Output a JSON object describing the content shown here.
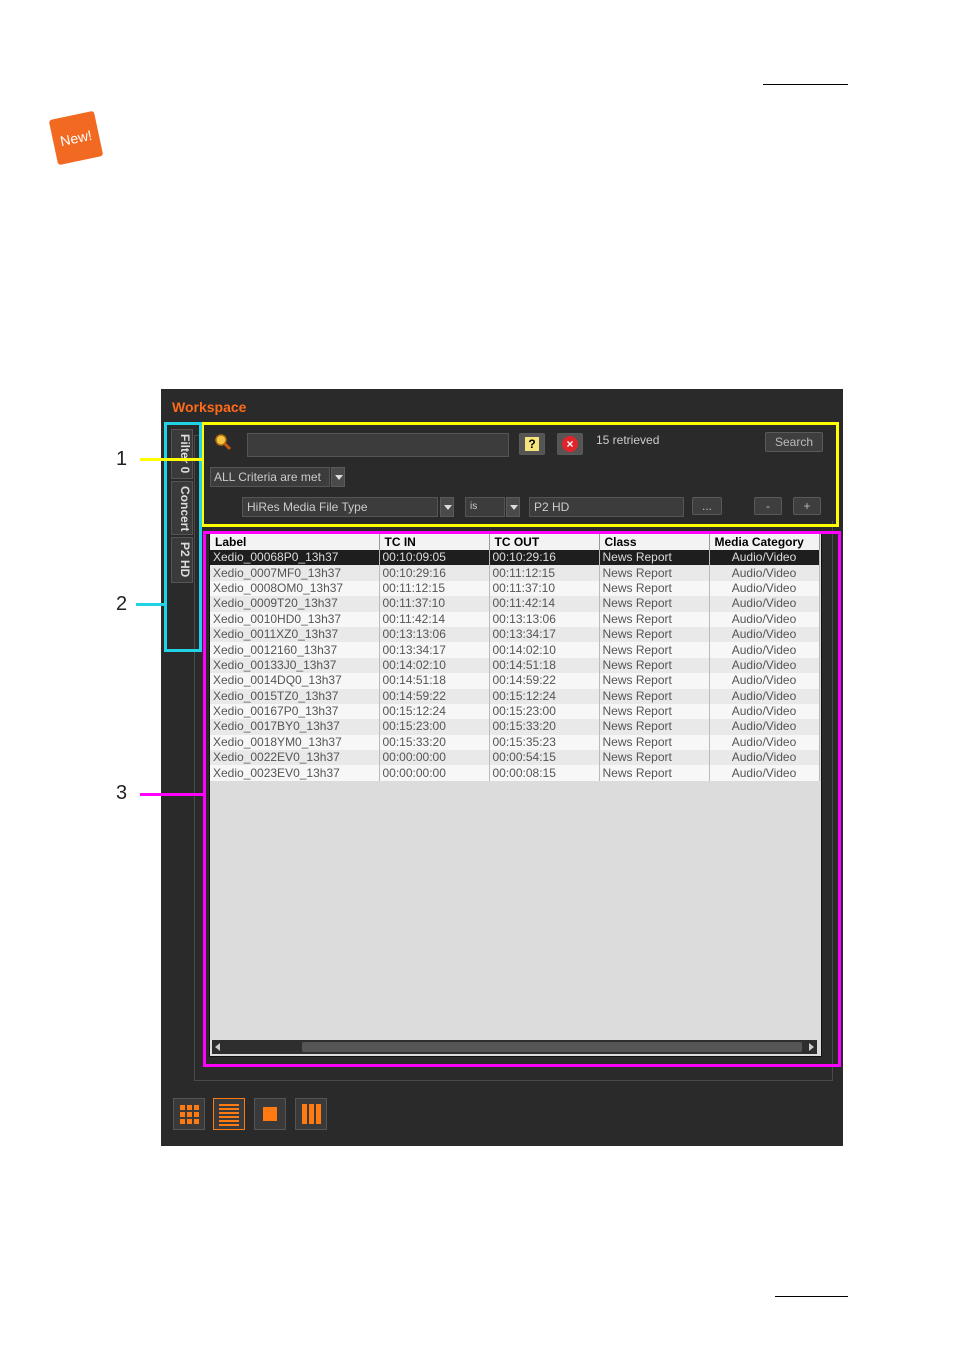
{
  "badge": {
    "label": "New!"
  },
  "workspace": {
    "title": "Workspace",
    "tabs": [
      "Filter 0",
      "Concert",
      "P2 HD"
    ],
    "search": {
      "query_value": "",
      "retrieved_text": "15 retrieved",
      "search_label": "Search",
      "criteria_mode": "ALL Criteria are met",
      "field": "HiRes Media File Type",
      "operator": "is",
      "value": "P2 HD",
      "browse_label": "...",
      "minus_label": "-",
      "plus_label": "+"
    },
    "grid": {
      "columns": [
        "Label",
        "TC IN",
        "TC OUT",
        "Class",
        "Media Category"
      ],
      "rows": [
        [
          "Xedio_00068P0_13h37",
          "00:10:09:05",
          "00:10:29:16",
          "News Report",
          "Audio/Video"
        ],
        [
          "Xedio_0007MF0_13h37",
          "00:10:29:16",
          "00:11:12:15",
          "News Report",
          "Audio/Video"
        ],
        [
          "Xedio_0008OM0_13h37",
          "00:11:12:15",
          "00:11:37:10",
          "News Report",
          "Audio/Video"
        ],
        [
          "Xedio_0009T20_13h37",
          "00:11:37:10",
          "00:11:42:14",
          "News Report",
          "Audio/Video"
        ],
        [
          "Xedio_0010HD0_13h37",
          "00:11:42:14",
          "00:13:13:06",
          "News Report",
          "Audio/Video"
        ],
        [
          "Xedio_0011XZ0_13h37",
          "00:13:13:06",
          "00:13:34:17",
          "News Report",
          "Audio/Video"
        ],
        [
          "Xedio_0012160_13h37",
          "00:13:34:17",
          "00:14:02:10",
          "News Report",
          "Audio/Video"
        ],
        [
          "Xedio_00133J0_13h37",
          "00:14:02:10",
          "00:14:51:18",
          "News Report",
          "Audio/Video"
        ],
        [
          "Xedio_0014DQ0_13h37",
          "00:14:51:18",
          "00:14:59:22",
          "News Report",
          "Audio/Video"
        ],
        [
          "Xedio_0015TZ0_13h37",
          "00:14:59:22",
          "00:15:12:24",
          "News Report",
          "Audio/Video"
        ],
        [
          "Xedio_00167P0_13h37",
          "00:15:12:24",
          "00:15:23:00",
          "News Report",
          "Audio/Video"
        ],
        [
          "Xedio_0017BY0_13h37",
          "00:15:23:00",
          "00:15:33:20",
          "News Report",
          "Audio/Video"
        ],
        [
          "Xedio_0018YM0_13h37",
          "00:15:33:20",
          "00:15:35:23",
          "News Report",
          "Audio/Video"
        ],
        [
          "Xedio_0022EV0_13h37",
          "00:00:00:00",
          "00:00:54:15",
          "News Report",
          "Audio/Video"
        ],
        [
          "Xedio_0023EV0_13h37",
          "00:00:00:00",
          "00:00:08:15",
          "News Report",
          "Audio/Video"
        ]
      ]
    }
  },
  "callouts": [
    "1",
    "2",
    "3"
  ],
  "colors": {
    "accent": "#ff6a1a",
    "callout1": "#ffff00",
    "callout2": "#22d3e6",
    "callout3": "#ff00ff"
  }
}
